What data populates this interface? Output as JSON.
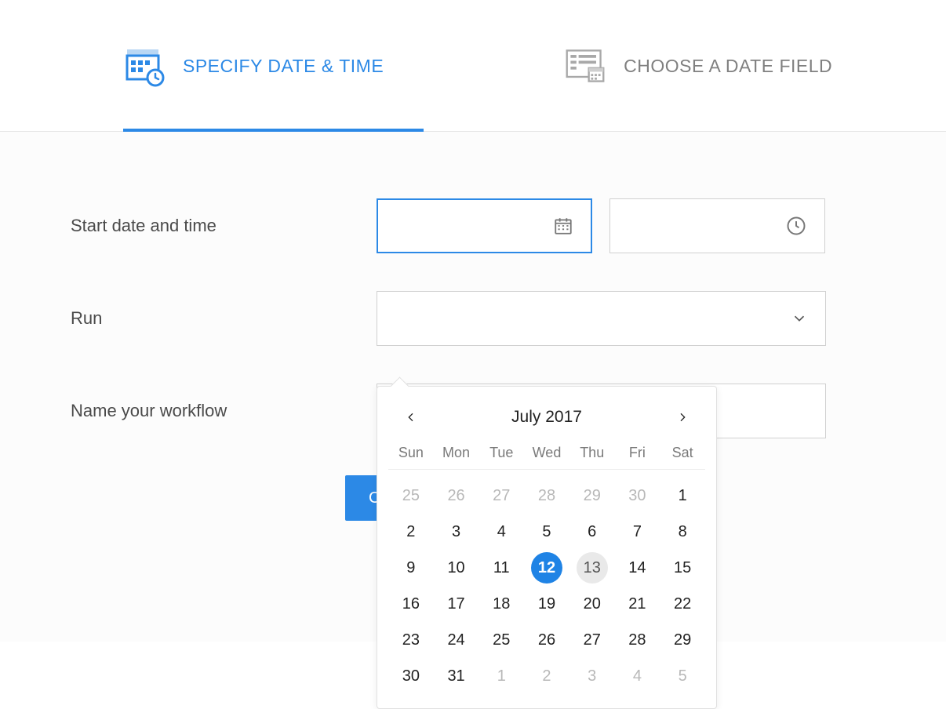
{
  "tabs": {
    "specify": {
      "label": "SPECIFY DATE & TIME",
      "active": true
    },
    "choose": {
      "label": "CHOOSE A DATE FIELD",
      "active": false
    }
  },
  "labels": {
    "start": "Start date and time",
    "run": "Run",
    "name": "Name your workflow"
  },
  "fields": {
    "date_value": "",
    "time_value": "",
    "run_value": "",
    "name_value": ""
  },
  "button": {
    "create": "Create"
  },
  "calendar": {
    "month_label": "July 2017",
    "daynames": [
      "Sun",
      "Mon",
      "Tue",
      "Wed",
      "Thu",
      "Fri",
      "Sat"
    ],
    "selected_day": 12,
    "today_day": 13,
    "cells": [
      {
        "d": 25,
        "other": true
      },
      {
        "d": 26,
        "other": true
      },
      {
        "d": 27,
        "other": true
      },
      {
        "d": 28,
        "other": true
      },
      {
        "d": 29,
        "other": true
      },
      {
        "d": 30,
        "other": true
      },
      {
        "d": 1
      },
      {
        "d": 2
      },
      {
        "d": 3
      },
      {
        "d": 4
      },
      {
        "d": 5
      },
      {
        "d": 6
      },
      {
        "d": 7
      },
      {
        "d": 8
      },
      {
        "d": 9
      },
      {
        "d": 10
      },
      {
        "d": 11
      },
      {
        "d": 12
      },
      {
        "d": 13
      },
      {
        "d": 14
      },
      {
        "d": 15
      },
      {
        "d": 16
      },
      {
        "d": 17
      },
      {
        "d": 18
      },
      {
        "d": 19
      },
      {
        "d": 20
      },
      {
        "d": 21
      },
      {
        "d": 22
      },
      {
        "d": 23
      },
      {
        "d": 24
      },
      {
        "d": 25
      },
      {
        "d": 26
      },
      {
        "d": 27
      },
      {
        "d": 28
      },
      {
        "d": 29
      },
      {
        "d": 30
      },
      {
        "d": 31
      },
      {
        "d": 1,
        "other": true
      },
      {
        "d": 2,
        "other": true
      },
      {
        "d": 3,
        "other": true
      },
      {
        "d": 4,
        "other": true
      },
      {
        "d": 5,
        "other": true
      }
    ]
  },
  "colors": {
    "accent": "#2c89e6"
  }
}
